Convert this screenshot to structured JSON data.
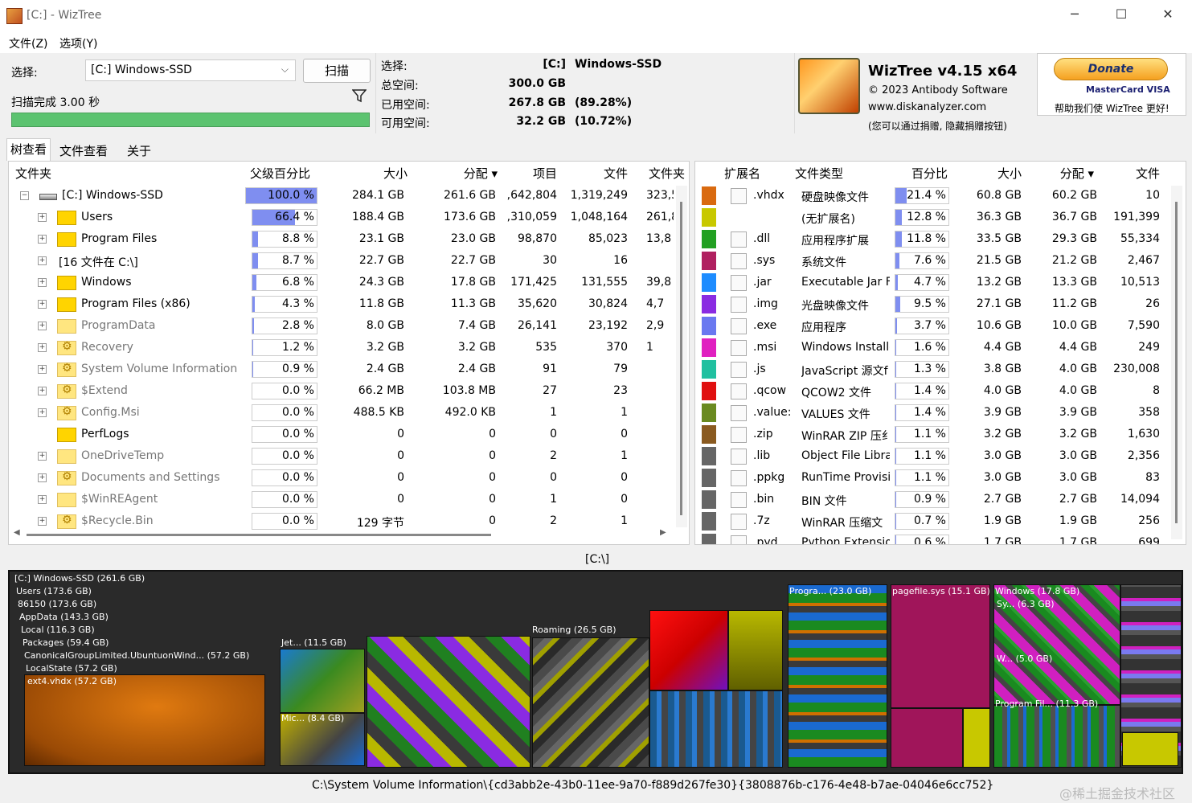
{
  "window": {
    "title": "[C:]  - WizTree"
  },
  "menu": [
    "文件(Z)",
    "选项(Y)"
  ],
  "select": {
    "label": "选择:",
    "drive": "[C:] Windows-SSD",
    "scan_button": "扫描",
    "status": "扫描完成 3.00 秒"
  },
  "info": {
    "rows": [
      {
        "label": "选择:",
        "value": "[C:]",
        "extra": "Windows-SSD"
      },
      {
        "label": "总空间:",
        "value": "300.0 GB",
        "extra": ""
      },
      {
        "label": "已用空间:",
        "value": "267.8 GB",
        "extra": "(89.28%)"
      },
      {
        "label": "可用空间:",
        "value": "32.2 GB",
        "extra": "(10.72%)"
      }
    ]
  },
  "about": {
    "name": "WizTree v4.15 x64",
    "copyright": "© 2023 Antibody Software",
    "url": "www.diskanalyzer.com",
    "note": "(您可以通过捐赠, 隐藏捐赠按钮)"
  },
  "donate": {
    "button": "Donate",
    "cards": "MasterCard VISA",
    "note": "帮助我们使 WizTree 更好!"
  },
  "tabs": [
    "树查看",
    "文件查看",
    "关于"
  ],
  "tree": {
    "headers": [
      "文件夹",
      "父级百分比",
      "大小",
      "分配 ▾",
      "项目",
      "文件",
      "文件夹"
    ],
    "rows": [
      {
        "name": "[C:] Windows-SSD",
        "pct": "100.0 %",
        "pctval": 100,
        "size": "284.1 GB",
        "alloc": "261.6 GB",
        "items": ",642,804",
        "files": "1,319,249",
        "folders": "323,5",
        "type": "drive",
        "gray": false
      },
      {
        "name": "Users",
        "pct": "66.4 %",
        "pctval": 66.4,
        "size": "188.4 GB",
        "alloc": "173.6 GB",
        "items": ",310,059",
        "files": "1,048,164",
        "folders": "261,8",
        "type": "folder",
        "gray": false
      },
      {
        "name": "Program Files",
        "pct": "8.8 %",
        "pctval": 8.8,
        "size": "23.1 GB",
        "alloc": "23.0 GB",
        "items": "98,870",
        "files": "85,023",
        "folders": "13,8",
        "type": "folder",
        "gray": false
      },
      {
        "name": "[16 文件在 C:\\]",
        "pct": "8.7 %",
        "pctval": 8.7,
        "size": "22.7 GB",
        "alloc": "22.7 GB",
        "items": "30",
        "files": "16",
        "folders": "",
        "type": "none",
        "gray": false
      },
      {
        "name": "Windows",
        "pct": "6.8 %",
        "pctval": 6.8,
        "size": "24.3 GB",
        "alloc": "17.8 GB",
        "items": "171,425",
        "files": "131,555",
        "folders": "39,8",
        "type": "folder",
        "gray": false
      },
      {
        "name": "Program Files (x86)",
        "pct": "4.3 %",
        "pctval": 4.3,
        "size": "11.8 GB",
        "alloc": "11.3 GB",
        "items": "35,620",
        "files": "30,824",
        "folders": "4,7",
        "type": "folder",
        "gray": false
      },
      {
        "name": "ProgramData",
        "pct": "2.8 %",
        "pctval": 2.8,
        "size": "8.0 GB",
        "alloc": "7.4 GB",
        "items": "26,141",
        "files": "23,192",
        "folders": "2,9",
        "type": "folder-light",
        "gray": true
      },
      {
        "name": "Recovery",
        "pct": "1.2 %",
        "pctval": 1.2,
        "size": "3.2 GB",
        "alloc": "3.2 GB",
        "items": "535",
        "files": "370",
        "folders": "1",
        "type": "gear",
        "gray": true
      },
      {
        "name": "System Volume Information",
        "pct": "0.9 %",
        "pctval": 0.9,
        "size": "2.4 GB",
        "alloc": "2.4 GB",
        "items": "91",
        "files": "79",
        "folders": "",
        "type": "gear",
        "gray": true
      },
      {
        "name": "$Extend",
        "pct": "0.0 %",
        "pctval": 0,
        "size": "66.2 MB",
        "alloc": "103.8 MB",
        "items": "27",
        "files": "23",
        "folders": "",
        "type": "gear",
        "gray": true
      },
      {
        "name": "Config.Msi",
        "pct": "0.0 %",
        "pctval": 0,
        "size": "488.5 KB",
        "alloc": "492.0 KB",
        "items": "1",
        "files": "1",
        "folders": "",
        "type": "gear",
        "gray": true
      },
      {
        "name": "PerfLogs",
        "pct": "0.0 %",
        "pctval": 0,
        "size": "0",
        "alloc": "0",
        "items": "0",
        "files": "0",
        "folders": "",
        "type": "folder",
        "gray": false
      },
      {
        "name": "OneDriveTemp",
        "pct": "0.0 %",
        "pctval": 0,
        "size": "0",
        "alloc": "0",
        "items": "2",
        "files": "1",
        "folders": "",
        "type": "folder-light",
        "gray": true
      },
      {
        "name": "Documents and Settings",
        "pct": "0.0 %",
        "pctval": 0,
        "size": "0",
        "alloc": "0",
        "items": "0",
        "files": "0",
        "folders": "",
        "type": "gear",
        "gray": true
      },
      {
        "name": "$WinREAgent",
        "pct": "0.0 %",
        "pctval": 0,
        "size": "0",
        "alloc": "0",
        "items": "1",
        "files": "0",
        "folders": "",
        "type": "folder-light",
        "gray": true
      },
      {
        "name": "$Recycle.Bin",
        "pct": "0.0 %",
        "pctval": 0,
        "size": "129 字节",
        "alloc": "0",
        "items": "2",
        "files": "1",
        "folders": "",
        "type": "gear",
        "gray": true
      }
    ]
  },
  "ext": {
    "headers": [
      "扩展名",
      "文件类型",
      "百分比",
      "大小",
      "分配 ▾",
      "文件"
    ],
    "rows": [
      {
        "color": "#d96a10",
        "icon": "drive",
        "ext": ".vhdx",
        "type": "硬盘映像文件",
        "pct": "21.4 %",
        "pctval": 21.4,
        "size": "60.8 GB",
        "alloc": "60.2 GB",
        "files": "10"
      },
      {
        "color": "#c8c800",
        "icon": "",
        "ext": "",
        "type": "(无扩展名)",
        "pct": "12.8 %",
        "pctval": 12.8,
        "size": "36.3 GB",
        "alloc": "36.7 GB",
        "files": "191,399"
      },
      {
        "color": "#22a022",
        "icon": "dll",
        "ext": ".dll",
        "type": "应用程序扩展",
        "pct": "11.8 %",
        "pctval": 11.8,
        "size": "33.5 GB",
        "alloc": "29.3 GB",
        "files": "55,334"
      },
      {
        "color": "#b02060",
        "icon": "sys",
        "ext": ".sys",
        "type": "系统文件",
        "pct": "7.6 %",
        "pctval": 7.6,
        "size": "21.5 GB",
        "alloc": "21.2 GB",
        "files": "2,467"
      },
      {
        "color": "#1e8cff",
        "icon": "jar",
        "ext": ".jar",
        "type": "Executable Jar Fi",
        "pct": "4.7 %",
        "pctval": 4.7,
        "size": "13.2 GB",
        "alloc": "13.3 GB",
        "files": "10,513"
      },
      {
        "color": "#8a2be2",
        "icon": "img",
        "ext": ".img",
        "type": "光盘映像文件",
        "pct": "9.5 %",
        "pctval": 9.5,
        "size": "27.1 GB",
        "alloc": "11.2 GB",
        "files": "26"
      },
      {
        "color": "#6a78f0",
        "icon": "exe",
        "ext": ".exe",
        "type": "应用程序",
        "pct": "3.7 %",
        "pctval": 3.7,
        "size": "10.6 GB",
        "alloc": "10.0 GB",
        "files": "7,590"
      },
      {
        "color": "#e020c0",
        "icon": "msi",
        "ext": ".msi",
        "type": "Windows Installe",
        "pct": "1.6 %",
        "pctval": 1.6,
        "size": "4.4 GB",
        "alloc": "4.4 GB",
        "files": "249"
      },
      {
        "color": "#20c0a0",
        "icon": "JS",
        "ext": ".js",
        "type": "JavaScript 源文f",
        "pct": "1.3 %",
        "pctval": 1.3,
        "size": "3.8 GB",
        "alloc": "4.0 GB",
        "files": "230,008"
      },
      {
        "color": "#e01010",
        "icon": "doc",
        "ext": ".qcow",
        "type": "QCOW2 文件",
        "pct": "1.4 %",
        "pctval": 1.4,
        "size": "4.0 GB",
        "alloc": "4.0 GB",
        "files": "8"
      },
      {
        "color": "#6a8a20",
        "icon": "doc",
        "ext": ".value:",
        "type": "VALUES 文件",
        "pct": "1.4 %",
        "pctval": 1.4,
        "size": "3.9 GB",
        "alloc": "3.9 GB",
        "files": "358"
      },
      {
        "color": "#8a5a20",
        "icon": "zip",
        "ext": ".zip",
        "type": "WinRAR ZIP 压纟",
        "pct": "1.1 %",
        "pctval": 1.1,
        "size": "3.2 GB",
        "alloc": "3.2 GB",
        "files": "1,630"
      },
      {
        "color": "#666666",
        "icon": "lib",
        "ext": ".lib",
        "type": "Object File Libra",
        "pct": "1.1 %",
        "pctval": 1.1,
        "size": "3.0 GB",
        "alloc": "3.0 GB",
        "files": "2,356"
      },
      {
        "color": "#666666",
        "icon": "exe",
        "ext": ".ppkg",
        "type": "RunTime Provisi",
        "pct": "1.1 %",
        "pctval": 1.1,
        "size": "3.0 GB",
        "alloc": "3.0 GB",
        "files": "83"
      },
      {
        "color": "#666666",
        "icon": "doc",
        "ext": ".bin",
        "type": "BIN 文件",
        "pct": "0.9 %",
        "pctval": 0.9,
        "size": "2.7 GB",
        "alloc": "2.7 GB",
        "files": "14,094"
      },
      {
        "color": "#666666",
        "icon": "zip",
        "ext": ".7z",
        "type": "WinRAR 压缩文",
        "pct": "0.7 %",
        "pctval": 0.7,
        "size": "1.9 GB",
        "alloc": "1.9 GB",
        "files": "256"
      },
      {
        "color": "#666666",
        "icon": "py",
        "ext": ".pyd",
        "type": "Python Extensior",
        "pct": "0.6 %",
        "pctval": 0.6,
        "size": "1.7 GB",
        "alloc": "1.7 GB",
        "files": "699"
      }
    ]
  },
  "treemap": {
    "path": "[C:\\]",
    "labels": [
      "[C:] Windows-SSD  (261.6 GB)",
      "Users  (173.6 GB)",
      "86150  (173.6 GB)",
      "AppData  (143.3 GB)",
      "Local  (116.3 GB)",
      "Packages  (59.4 GB)",
      "CanonicalGroupLimited.UbuntuonWind... (57.2 GB)",
      "LocalState  (57.2 GB)",
      "ext4.vhdx  (57.2 GB)",
      "Jet... (11.5 GB)",
      "Mic... (8.4 GB)",
      "Roaming  (26.5 GB)",
      "Progra... (23.0 GB)",
      "pagefile.sys (15.1 GB)",
      "Windows  (17.8 GB)",
      "Sy... (6.3 GB)",
      "W... (5.0 GB)",
      "Program Fil... (11.3 GB)"
    ]
  },
  "status": {
    "path": "C:\\System Volume Information\\{cd3abb2e-43b0-11ee-9a70-f889d267fe30}{3808876b-c176-4e48-b7ae-04046e6cc752}"
  },
  "watermark": "@稀土掘金技术社区"
}
